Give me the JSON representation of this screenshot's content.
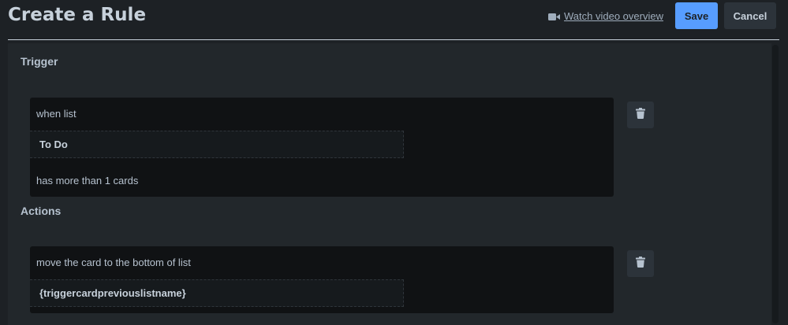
{
  "header": {
    "title": "Create a Rule",
    "video_link_label": "Watch video overview",
    "save_label": "Save",
    "cancel_label": "Cancel"
  },
  "trigger": {
    "section_label": "Trigger",
    "line1": "when list",
    "field_value": "To Do",
    "line2": "has more than 1 cards",
    "delete_icon": "trash-icon"
  },
  "actions": {
    "section_label": "Actions",
    "line1": "move the card to the bottom of list",
    "field_value": "{triggercardpreviouslistname}",
    "delete_icon": "trash-icon"
  },
  "colors": {
    "background": "#1d2125",
    "panel": "#22272b",
    "card": "#101214",
    "primary_button": "#579dff",
    "secondary_button": "#2c333a",
    "text": "#b6c2cf"
  }
}
